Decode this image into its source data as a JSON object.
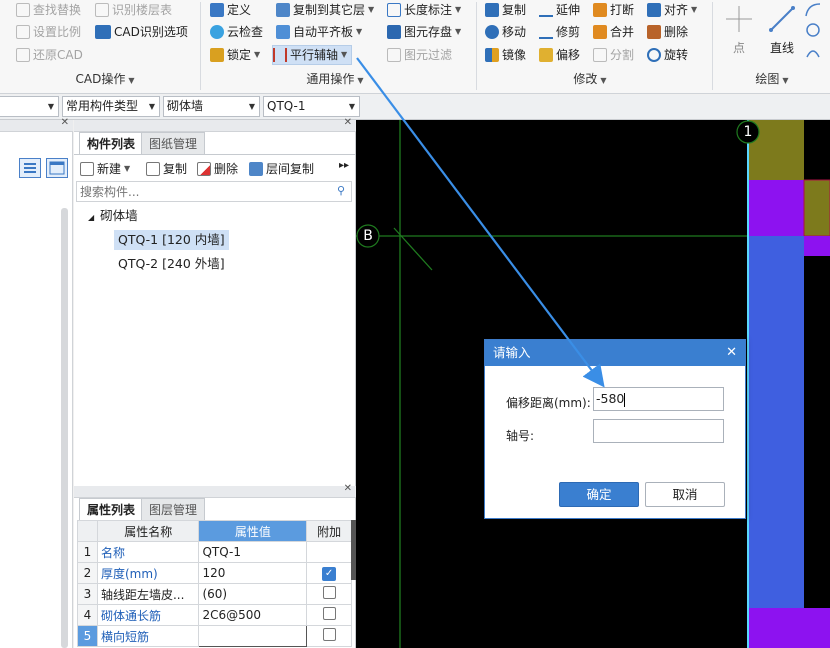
{
  "ribbon": {
    "cad_ops": {
      "find_replace": "查找替换",
      "identify_floor_table": "识别楼层表",
      "set_scale": "设置比例",
      "cad_recognition_options": "CAD识别选项",
      "restore_cad": "还原CAD",
      "group_label": "CAD操作"
    },
    "general_ops": {
      "define": "定义",
      "copy_to_other_floor": "复制到其它层",
      "length_dimension": "长度标注",
      "cloud_check": "云检查",
      "auto_flat_slab": "自动平齐板",
      "element_save": "图元存盘",
      "lock": "锁定",
      "parallel_aux_axis": "平行辅轴",
      "element_filter": "图元过滤",
      "group_label": "通用操作"
    },
    "modify": {
      "copy": "复制",
      "extend": "延伸",
      "break": "打断",
      "align": "对齐",
      "move": "移动",
      "trim": "修剪",
      "merge": "合并",
      "delete": "删除",
      "mirror": "镜像",
      "offset": "偏移",
      "split": "分割",
      "rotate": "旋转",
      "group_label": "修改"
    },
    "draw": {
      "point": "点",
      "line": "直线",
      "group_label": "绘图"
    }
  },
  "toolbar": {
    "combo_type": "常用构件类型",
    "combo_category": "砌体墙",
    "combo_element": "QTQ-1"
  },
  "component_panel": {
    "tabs": [
      "构件列表",
      "图纸管理"
    ],
    "actions": {
      "new": "新建",
      "copy": "复制",
      "delete": "删除",
      "floor_copy": "层间复制"
    },
    "search_placeholder": "搜索构件...",
    "tree": {
      "root": "砌体墙",
      "items": [
        "QTQ-1 [120 内墙]",
        "QTQ-2 [240 外墙]"
      ]
    }
  },
  "property_panel": {
    "tabs": [
      "属性列表",
      "图层管理"
    ],
    "headers": [
      "属性名称",
      "属性值",
      "附加"
    ],
    "rows": [
      {
        "num": "1",
        "name": "名称",
        "value": "QTQ-1",
        "checked": null
      },
      {
        "num": "2",
        "name": "厚度(mm)",
        "value": "120",
        "checked": true
      },
      {
        "num": "3",
        "name": "轴线距左墙皮...",
        "value": "(60)",
        "checked": false
      },
      {
        "num": "4",
        "name": "砌体通长筋",
        "value": "2C6@500",
        "checked": false
      },
      {
        "num": "5",
        "name": "横向短筋",
        "value": "",
        "checked": false
      }
    ]
  },
  "canvas": {
    "axis_b": "B",
    "axis_1": "1"
  },
  "dialog": {
    "title": "请输入",
    "offset_label": "偏移距离(mm):",
    "offset_value": "-580",
    "axis_label": "轴号:",
    "axis_value": "",
    "ok": "确定",
    "cancel": "取消"
  },
  "colors": {
    "accent": "#3a7fd0",
    "canvas_bg": "#000000",
    "grid_green": "#1f7a1f",
    "wall_blue": "#3f5fe0",
    "wall_purple": "#8d12f0",
    "wall_olive": "#7d7a1c",
    "annotation_arrow": "#3a8ee6"
  }
}
